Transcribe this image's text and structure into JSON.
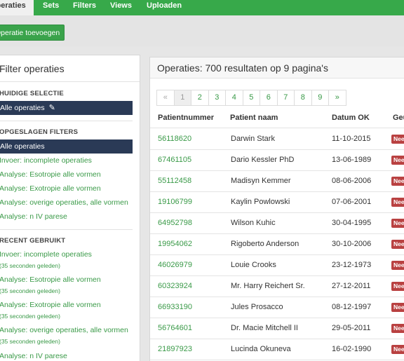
{
  "nav": {
    "tabs": [
      {
        "label": "Operaties"
      },
      {
        "label": "Sets"
      },
      {
        "label": "Filters"
      },
      {
        "label": "Views"
      },
      {
        "label": "Uploaden"
      }
    ]
  },
  "toolbar": {
    "add_label": "Operatie toevoegen"
  },
  "filters": {
    "title": "Filter operaties",
    "current_heading": "HUIDIGE SELECTIE",
    "current_value": "Alle operaties",
    "saved_heading": "OPGESLAGEN FILTERS",
    "saved_items": [
      "Alle operaties",
      "Invoer: incomplete operaties",
      "Analyse: Esotropie alle vormen",
      "Analyse: Exotropie alle vormen",
      "Analyse: overige operaties, alle vormen",
      "Analyse: n IV parese"
    ],
    "recent_heading": "RECENT GEBRUIKT",
    "recent_items": [
      {
        "label": "Invoer: incomplete operaties",
        "time": "(35 seconden geleden)"
      },
      {
        "label": "Analyse: Esotropie alle vormen",
        "time": "(35 seconden geleden)"
      },
      {
        "label": "Analyse: Exotropie alle vormen",
        "time": "(35 seconden geleden)"
      },
      {
        "label": "Analyse: overige operaties, alle vormen",
        "time": "(35 seconden geleden)"
      },
      {
        "label": "Analyse: n IV parese",
        "time": ""
      }
    ]
  },
  "results": {
    "title": "Operaties: 700 resultaten op 9 pagina's",
    "pager": [
      "«",
      "1",
      "2",
      "3",
      "4",
      "5",
      "6",
      "7",
      "8",
      "9",
      "»"
    ],
    "columns": [
      "Patientnummer",
      "Patient naam",
      "Datum OK",
      "Geü"
    ],
    "badge": "Nee",
    "rows": [
      {
        "nr": "56118620",
        "name": "Darwin Stark",
        "date": "11-10-2015"
      },
      {
        "nr": "67461105",
        "name": "Dario Kessler PhD",
        "date": "13-06-1989"
      },
      {
        "nr": "55112458",
        "name": "Madisyn Kemmer",
        "date": "08-06-2006"
      },
      {
        "nr": "19106799",
        "name": "Kaylin Powlowski",
        "date": "07-06-2001"
      },
      {
        "nr": "64952798",
        "name": "Wilson Kuhic",
        "date": "30-04-1995"
      },
      {
        "nr": "19954062",
        "name": "Rigoberto Anderson",
        "date": "30-10-2006"
      },
      {
        "nr": "46026979",
        "name": "Louie Crooks",
        "date": "23-12-1973"
      },
      {
        "nr": "60323924",
        "name": "Mr. Harry Reichert Sr.",
        "date": "27-12-2011"
      },
      {
        "nr": "66933190",
        "name": "Jules Prosacco",
        "date": "08-12-1997"
      },
      {
        "nr": "56764601",
        "name": "Dr. Macie Mitchell II",
        "date": "29-05-2011"
      },
      {
        "nr": "21897923",
        "name": "Lucinda Okuneva",
        "date": "16-02-1990"
      }
    ]
  }
}
